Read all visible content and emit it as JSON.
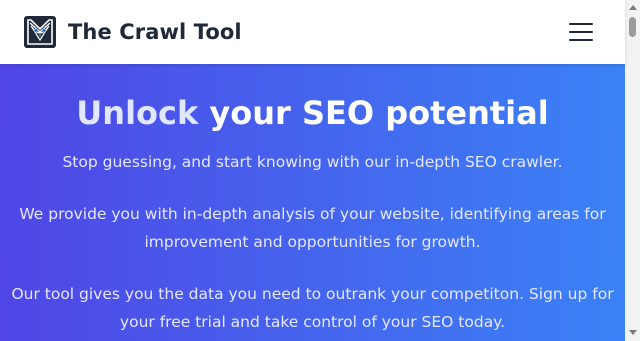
{
  "header": {
    "brand": "The Crawl Tool",
    "logo_icon": "cat-icon",
    "menu_icon": "hamburger-menu-icon"
  },
  "hero": {
    "title_accent": "Unlock",
    "title_rest": " your SEO potential",
    "paragraphs": [
      "Stop guessing, and start knowing with our in-depth SEO crawler.",
      "We provide you with in-depth analysis of your website, identifying areas for improvement and opportunities for growth.",
      "Our tool gives you the data you need to outrank your competiton. Sign up for your free trial and take control of your SEO today."
    ]
  },
  "colors": {
    "gradient_start": "#4f46e5",
    "gradient_end": "#3b82f6",
    "title_accent": "#e0e7ff"
  }
}
